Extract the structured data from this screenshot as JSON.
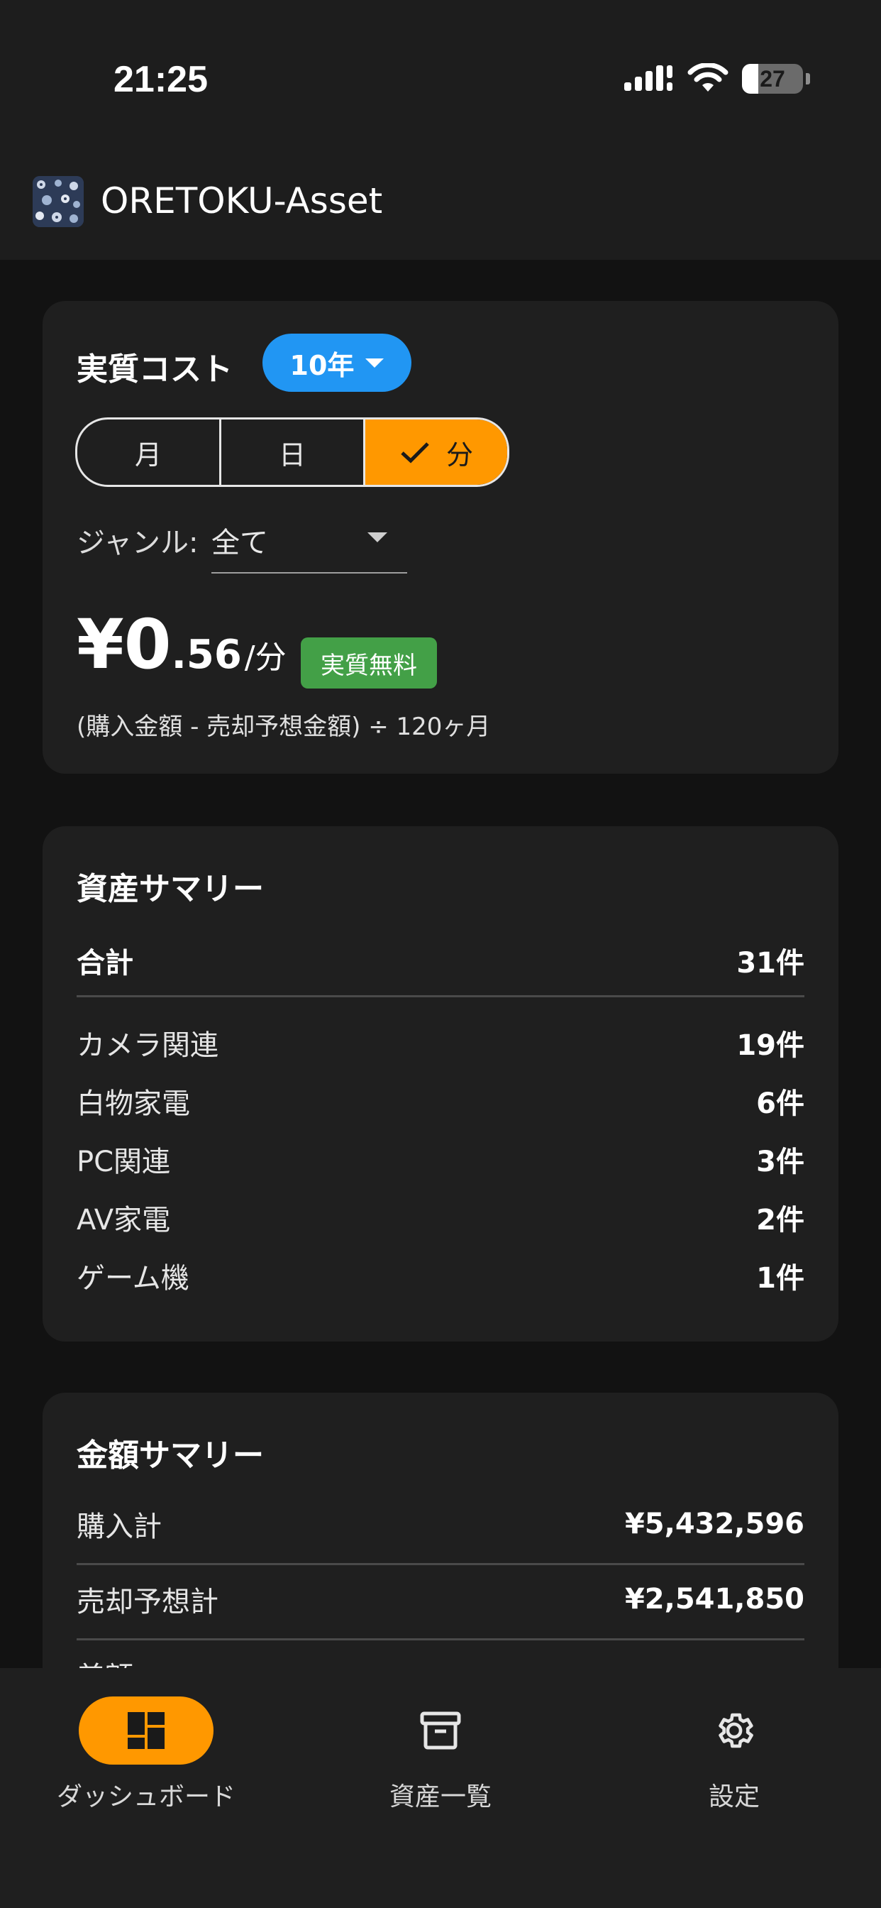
{
  "status_bar": {
    "time": "21:25",
    "battery_level": "27",
    "battery_fraction": 0.27
  },
  "app_bar": {
    "title": "ORETOKU-Asset",
    "logo_icon": "app-logo-icon"
  },
  "cost_card": {
    "title": "実質コスト",
    "period_chip": "10年",
    "segments": [
      {
        "label": "月",
        "selected": false
      },
      {
        "label": "日",
        "selected": false
      },
      {
        "label": "分",
        "selected": true
      }
    ],
    "genre_label": "ジャンル:",
    "genre_value": "全て",
    "price_main": "¥0",
    "price_fraction": ".56",
    "price_unit": "/分",
    "badge": "実質無料",
    "formula": "(購入金額 - 売却予想金額) ÷ 120ヶ月"
  },
  "asset_summary": {
    "title": "資産サマリー",
    "total_label": "合計",
    "total_value": "31件",
    "rows": [
      {
        "label": "カメラ関連",
        "value": "19件"
      },
      {
        "label": "白物家電",
        "value": "6件"
      },
      {
        "label": "PC関連",
        "value": "3件"
      },
      {
        "label": "AV家電",
        "value": "2件"
      },
      {
        "label": "ゲーム機",
        "value": "1件"
      }
    ]
  },
  "money_summary": {
    "title": "金額サマリー",
    "rows": [
      {
        "label": "購入計",
        "value": "¥5,432,596"
      },
      {
        "label": "売却予想計",
        "value": "¥2,541,850"
      },
      {
        "label": "差額",
        "value": ""
      }
    ]
  },
  "bottom_nav": {
    "items": [
      {
        "label": "ダッシュボード",
        "icon": "dashboard-icon",
        "active": true
      },
      {
        "label": "資産一覧",
        "icon": "archive-icon",
        "active": false
      },
      {
        "label": "設定",
        "icon": "gear-icon",
        "active": false
      }
    ]
  },
  "colors": {
    "accent": "#ff9800",
    "chip": "#2196f3",
    "badge": "#43a047",
    "background": "#121212",
    "card": "#1f1f1f"
  }
}
